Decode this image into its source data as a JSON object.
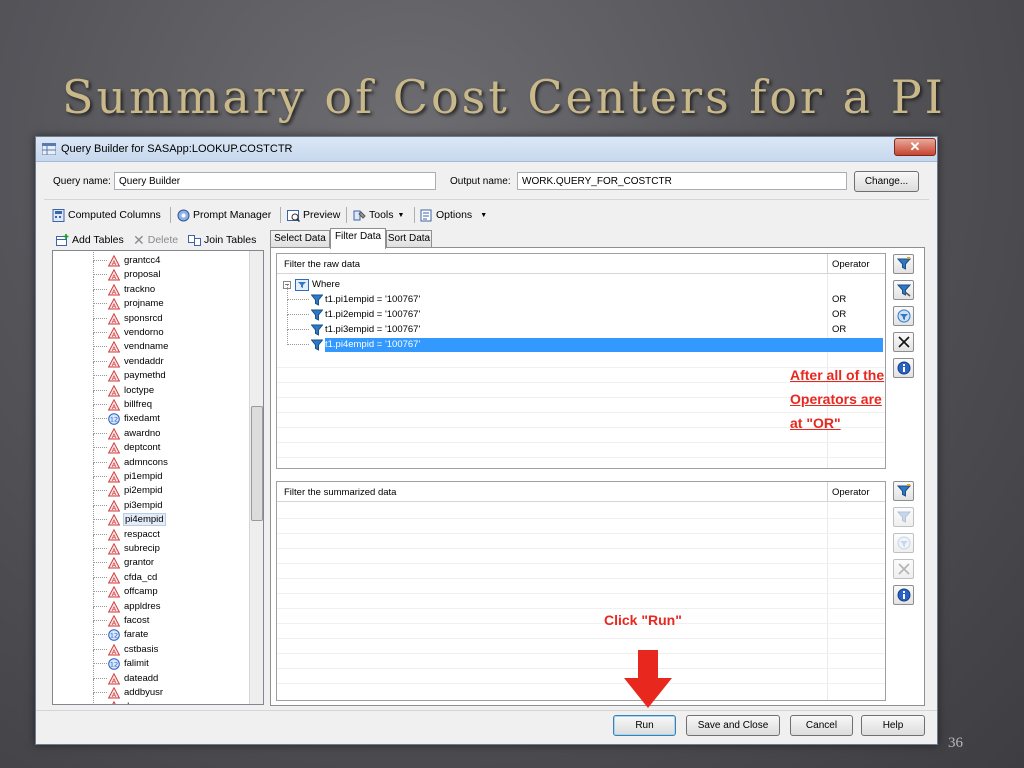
{
  "slide": {
    "title": "Summary of Cost Centers for a PI",
    "page_number": "36"
  },
  "window": {
    "title": "Query Builder for SASApp:LOOKUP.COSTCTR",
    "close_glyph": "✕"
  },
  "query": {
    "name_label": "Query name:",
    "name_value": "Query Builder",
    "output_label": "Output name:",
    "output_value": "WORK.QUERY_FOR_COSTCTR",
    "change_label": "Change..."
  },
  "toolbar": {
    "computed_columns": "Computed Columns",
    "prompt_manager": "Prompt Manager",
    "preview": "Preview",
    "tools": "Tools",
    "options": "Options"
  },
  "left_toolbar": {
    "add_tables": "Add Tables",
    "delete": "Delete",
    "join_tables": "Join Tables"
  },
  "columns": [
    {
      "name": "grantcc4",
      "type": "char"
    },
    {
      "name": "proposal",
      "type": "char"
    },
    {
      "name": "trackno",
      "type": "char"
    },
    {
      "name": "projname",
      "type": "char"
    },
    {
      "name": "sponsrcd",
      "type": "char"
    },
    {
      "name": "vendorno",
      "type": "char"
    },
    {
      "name": "vendname",
      "type": "char"
    },
    {
      "name": "vendaddr",
      "type": "char"
    },
    {
      "name": "paymethd",
      "type": "char"
    },
    {
      "name": "loctype",
      "type": "char"
    },
    {
      "name": "billfreq",
      "type": "char"
    },
    {
      "name": "fixedamt",
      "type": "num"
    },
    {
      "name": "awardno",
      "type": "char"
    },
    {
      "name": "deptcont",
      "type": "char"
    },
    {
      "name": "admncons",
      "type": "char"
    },
    {
      "name": "pi1empid",
      "type": "char"
    },
    {
      "name": "pi2empid",
      "type": "char"
    },
    {
      "name": "pi3empid",
      "type": "char"
    },
    {
      "name": "pi4empid",
      "type": "char",
      "selected": true
    },
    {
      "name": "respacct",
      "type": "char"
    },
    {
      "name": "subrecip",
      "type": "char"
    },
    {
      "name": "grantor",
      "type": "char"
    },
    {
      "name": "cfda_cd",
      "type": "char"
    },
    {
      "name": "offcamp",
      "type": "char"
    },
    {
      "name": "appldres",
      "type": "char"
    },
    {
      "name": "facost",
      "type": "char"
    },
    {
      "name": "farate",
      "type": "num"
    },
    {
      "name": "cstbasis",
      "type": "char"
    },
    {
      "name": "falimit",
      "type": "num"
    },
    {
      "name": "dateadd",
      "type": "char"
    },
    {
      "name": "addbyusr",
      "type": "char"
    },
    {
      "name": "dcv",
      "type": "char"
    }
  ],
  "tabs": [
    {
      "label": "Select Data",
      "active": false
    },
    {
      "label": "Filter Data",
      "active": true
    },
    {
      "label": "Sort Data",
      "active": false
    }
  ],
  "raw_filter": {
    "header": "Filter the raw data",
    "operator_header": "Operator",
    "root_label": "Where",
    "conditions": [
      {
        "text": "t1.pi1empid = '100767'",
        "operator": "OR"
      },
      {
        "text": "t1.pi2empid = '100767'",
        "operator": "OR"
      },
      {
        "text": "t1.pi3empid = '100767'",
        "operator": "OR"
      },
      {
        "text": "t1.pi4empid = '100767'",
        "operator": "",
        "selected": true
      }
    ]
  },
  "summary_filter": {
    "header": "Filter the summarized data",
    "operator_header": "Operator"
  },
  "annotations": {
    "operators_lines": [
      "After all of the",
      "Operators are",
      "at \"OR\""
    ],
    "run_note": "Click \"Run\""
  },
  "buttons": {
    "run": "Run",
    "save_close": "Save and Close",
    "cancel": "Cancel",
    "help": "Help"
  },
  "colors": {
    "annotation": "#e8271f",
    "selection": "#3399ff",
    "title": "#c9b88a"
  }
}
